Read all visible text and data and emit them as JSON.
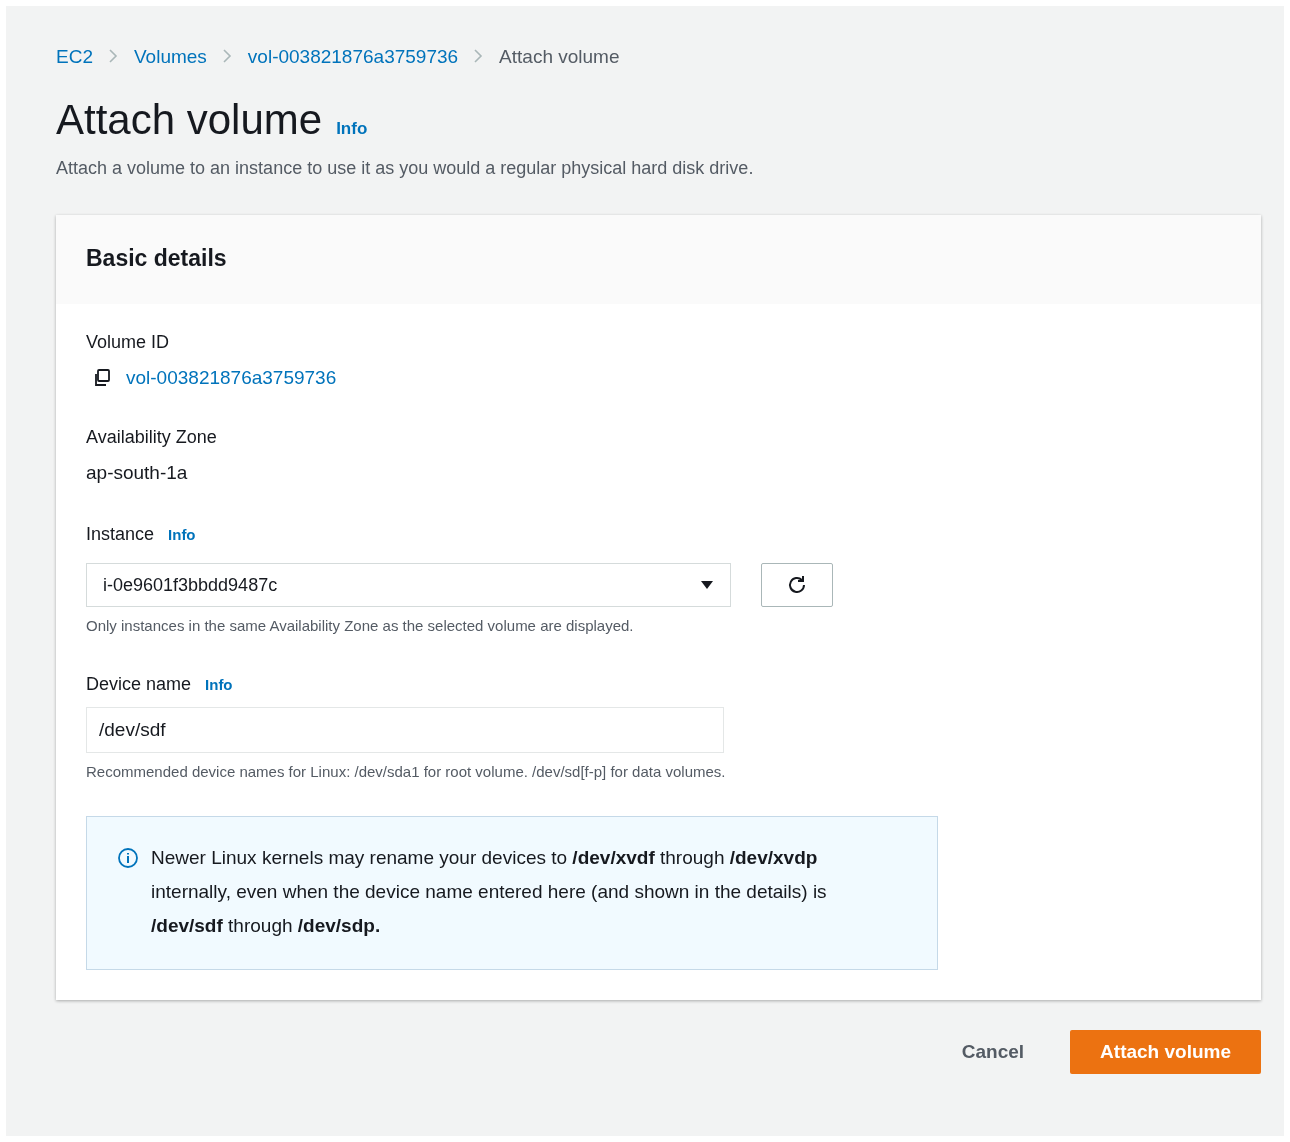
{
  "breadcrumb": [
    {
      "label": "EC2",
      "kind": "link"
    },
    {
      "label": "Volumes",
      "kind": "link"
    },
    {
      "label": "vol-003821876a3759736",
      "kind": "link"
    },
    {
      "label": "Attach volume",
      "kind": "current"
    }
  ],
  "page": {
    "title": "Attach volume",
    "info": "Info",
    "description": "Attach a volume to an instance to use it as you would a regular physical hard disk drive."
  },
  "card": {
    "title": "Basic details",
    "volume_id": {
      "label": "Volume ID",
      "value": "vol-003821876a3759736"
    },
    "availability_zone": {
      "label": "Availability Zone",
      "value": "ap-south-1a"
    },
    "instance": {
      "label": "Instance",
      "info": "Info",
      "value": "i-0e9601f3bbdd9487c",
      "hint": "Only instances in the same Availability Zone as the selected volume are displayed."
    },
    "device_name": {
      "label": "Device name",
      "info": "Info",
      "value": "/dev/sdf",
      "hint": "Recommended device names for Linux: /dev/sda1 for root volume. /dev/sd[f-p] for data volumes."
    },
    "alert": "Newer Linux kernels may rename your devices to **/dev/xvdf** through **/dev/xvdp** internally, even when the device name entered here (and shown in the details) is **/dev/sdf** through **/dev/sdp.**"
  },
  "buttons": [
    {
      "label": "Cancel",
      "kind": "link"
    },
    {
      "label": "Attach volume",
      "kind": "primary"
    }
  ]
}
